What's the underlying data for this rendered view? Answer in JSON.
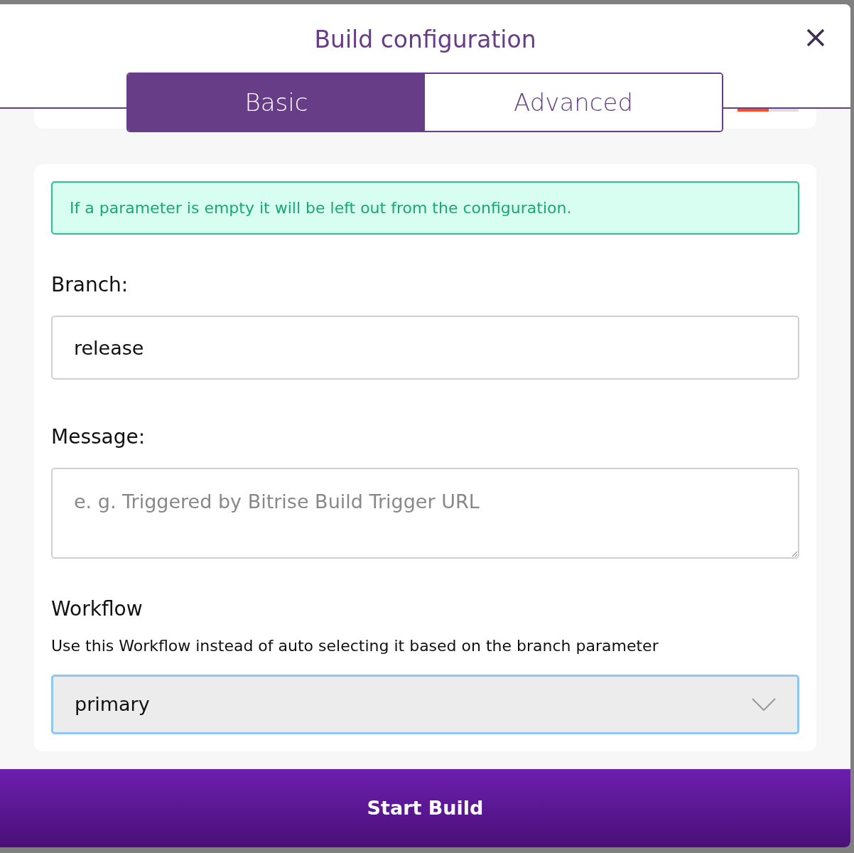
{
  "dialog": {
    "title": "Build configuration"
  },
  "tabs": [
    {
      "label": "Basic",
      "selected": true
    },
    {
      "label": "Advanced",
      "selected": false
    }
  ],
  "notice": "If a parameter is empty it will be left out from the configuration.",
  "branch": {
    "label": "Branch:",
    "value": "release"
  },
  "message": {
    "label": "Message:",
    "placeholder": "e. g. Triggered by Bitrise Build Trigger URL"
  },
  "workflow": {
    "label": "Workflow",
    "hint": "Use this Workflow instead of auto selecting it based on the branch parameter",
    "value": "primary"
  },
  "submit": "Start Build"
}
